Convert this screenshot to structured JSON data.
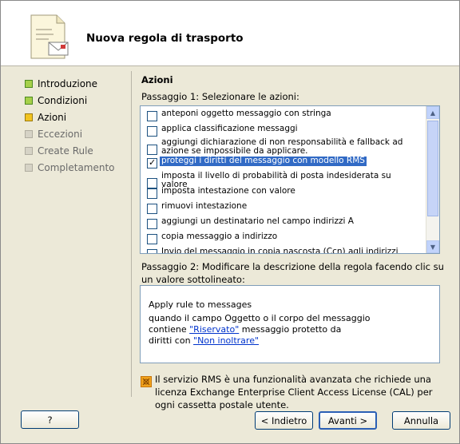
{
  "header": {
    "title": "Nuova regola di trasporto",
    "icon": "document-mail-icon"
  },
  "nav": {
    "items": [
      {
        "label": "Introduzione",
        "state": "done"
      },
      {
        "label": "Condizioni",
        "state": "done"
      },
      {
        "label": "Azioni",
        "state": "current"
      },
      {
        "label": "Eccezioni",
        "state": "pending"
      },
      {
        "label": "Create Rule",
        "state": "pending"
      },
      {
        "label": "Completamento",
        "state": "pending"
      }
    ]
  },
  "content": {
    "section_title": "Azioni",
    "step1_label": "Passaggio 1: Selezionare le azioni:",
    "actions": [
      {
        "lines": [
          "anteponi oggetto messaggio con stringa"
        ],
        "checked": false
      },
      {
        "lines": [
          "applica classificazione messaggi"
        ],
        "checked": false
      },
      {
        "lines": [
          "aggiungi dichiarazione di non responsabilità e fallback ad",
          "azione se impossibile da applicare."
        ],
        "checked": false
      },
      {
        "lines": [
          "proteggi i diritti del messaggio con modello RMS"
        ],
        "checked": true,
        "selected": true
      },
      {
        "lines": [
          "imposta il livello di probabilità di posta indesiderata su",
          "valore"
        ],
        "checked": false
      },
      {
        "lines": [
          "imposta intestazione con valore"
        ],
        "checked": false
      },
      {
        "lines": [
          "rimuovi intestazione"
        ],
        "checked": false
      },
      {
        "lines": [
          "aggiungi un destinatario nel campo indirizzi A"
        ],
        "checked": false
      },
      {
        "lines": [
          "copia messaggio a indirizzo"
        ],
        "checked": false
      },
      {
        "lines": [
          "Invio del messaggio in copia nascosta (Ccn) agli indirizzi"
        ],
        "checked": false
      }
    ],
    "step2_label": "Passaggio 2: Modificare la descrizione della regola facendo clic su un valore sottolineato:",
    "description": {
      "line1": "Apply rule to messages",
      "line2": "quando il campo Oggetto o il corpo del messaggio",
      "line3_prefix": "contiene ",
      "line3_link": "\"Riservato\"",
      "line3_suffix": " messaggio protetto da",
      "line4_prefix": "diritti con ",
      "line4_link": "\"Non inoltrare\""
    },
    "info_text": "Il servizio RMS è una funzionalità avanzata che richiede una licenza Exchange Enterprise Client Access License (CAL) per ogni cassetta postale utente."
  },
  "buttons": {
    "help": "?",
    "back": "< Indietro",
    "next": "Avanti >",
    "cancel": "Annulla"
  }
}
